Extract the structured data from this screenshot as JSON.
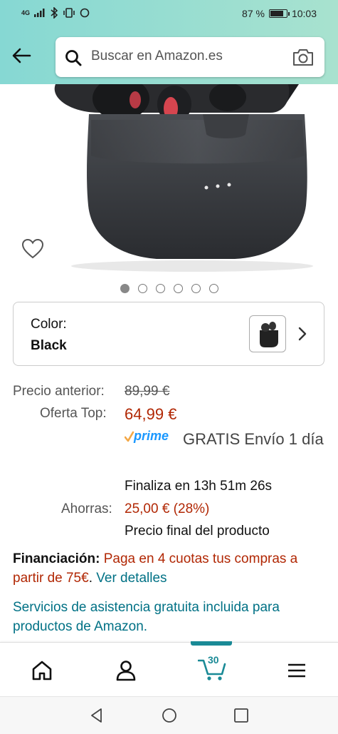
{
  "status_bar": {
    "network": "4G",
    "battery_percent": "87 %",
    "battery_level": 0.87,
    "time": "10:03"
  },
  "search": {
    "placeholder": "Buscar en Amazon.es"
  },
  "carousel": {
    "image_count": 6,
    "active_index": 0
  },
  "color_selector": {
    "label": "Color:",
    "value": "Black"
  },
  "pricing": {
    "previous_label": "Precio anterior:",
    "previous_price": "89,99 €",
    "offer_label": "Oferta Top:",
    "offer_price": "64,99 €",
    "prime_logo_text": "prime",
    "shipping": "GRATIS Envío 1 día",
    "countdown": "Finaliza en 13h 51m 26s",
    "savings_label": "Ahorras:",
    "savings_value": "25,00 € (28%)",
    "final_price_note": "Precio final del producto"
  },
  "financing": {
    "label": "Financiación:",
    "text": "Paga en 4 cuotas tus compras a partir de 75€",
    "separator": ".",
    "link": "Ver detalles"
  },
  "services_link": "Servicios de asistencia gratuita incluida para productos de Amazon.",
  "bottom_nav": {
    "cart_count": "30"
  },
  "colors": {
    "header_bg_start": "#86d8d3",
    "header_bg_end": "#a8e2cf",
    "price_red": "#b12704",
    "link_teal": "#007185",
    "prime_blue": "#1a98ff",
    "prime_check": "#f3a847",
    "cart_indicator": "#1a8a96"
  }
}
